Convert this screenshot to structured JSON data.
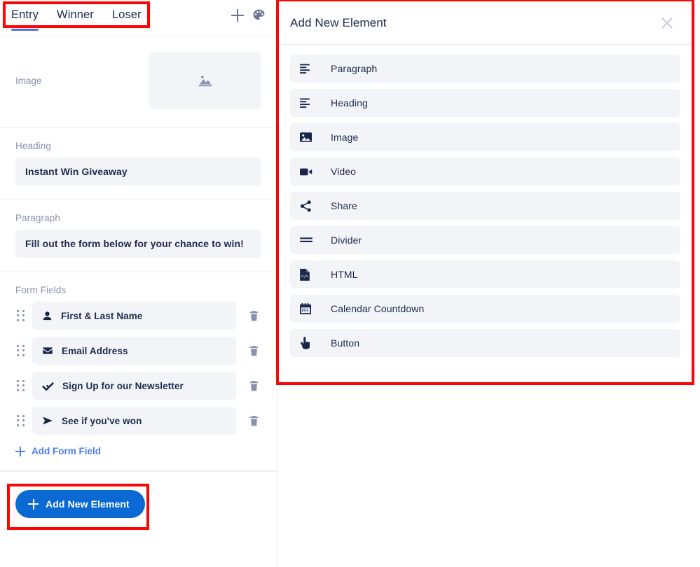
{
  "left_panel": {
    "tabs": [
      {
        "label": "Entry",
        "active": true
      },
      {
        "label": "Winner",
        "active": false
      },
      {
        "label": "Loser",
        "active": false
      }
    ],
    "tabbar_actions": [
      {
        "name": "add-icon",
        "icon": "plus-icon"
      },
      {
        "name": "palette-icon",
        "icon": "palette-icon"
      }
    ],
    "image_section": {
      "label": "Image",
      "placeholder_icon": "image-placeholder-icon"
    },
    "heading_section": {
      "label": "Heading",
      "value": "Instant Win Giveaway"
    },
    "paragraph_section": {
      "label": "Paragraph",
      "value": "Fill out the form below for your chance to win!"
    },
    "form_fields_section": {
      "label": "Form Fields",
      "fields": [
        {
          "label": "First & Last Name",
          "icon": "user-icon"
        },
        {
          "label": "Email Address",
          "icon": "envelope-icon"
        },
        {
          "label": "Sign Up for our Newsletter",
          "icon": "double-check-icon"
        },
        {
          "label": "See if you've won",
          "icon": "paper-plane-icon"
        }
      ],
      "add_field_label": "Add Form Field"
    },
    "footer": {
      "add_element_label": "Add New Element"
    }
  },
  "modal": {
    "title": "Add New Element",
    "close_label": "",
    "items": [
      {
        "label": "Paragraph",
        "icon": "align-left-icon"
      },
      {
        "label": "Heading",
        "icon": "align-left-icon"
      },
      {
        "label": "Image",
        "icon": "image-icon"
      },
      {
        "label": "Video",
        "icon": "video-icon"
      },
      {
        "label": "Share",
        "icon": "share-icon"
      },
      {
        "label": "Divider",
        "icon": "divider-icon"
      },
      {
        "label": "HTML",
        "icon": "code-file-icon"
      },
      {
        "label": "Calendar Countdown",
        "icon": "calendar-icon"
      },
      {
        "label": "Button",
        "icon": "hand-pointer-icon"
      }
    ]
  },
  "colors": {
    "accent_blue": "#0b69d4",
    "link_blue": "#4f7df3",
    "tab_underline": "#5c6fd4",
    "text_dark": "#1c2b4b",
    "text_muted": "#8a93ad",
    "field_bg": "#f2f4f8",
    "annotation_red": "#fb0505"
  }
}
